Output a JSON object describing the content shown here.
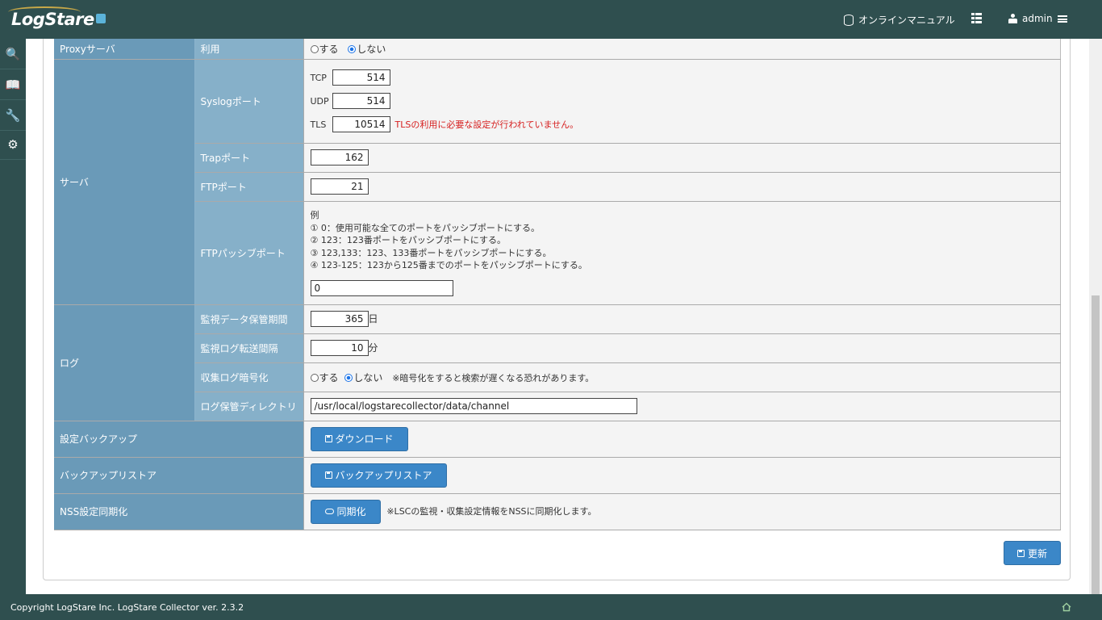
{
  "app": {
    "logo_text": "LogStare"
  },
  "topnav": {
    "manual_label": "オンラインマニュアル",
    "user_label": "admin"
  },
  "sidebar": {
    "items": [
      {
        "icon": "search-icon",
        "glyph": "🔍"
      },
      {
        "icon": "book-icon",
        "glyph": "📖"
      },
      {
        "icon": "wrench-icon",
        "glyph": "🔧"
      },
      {
        "icon": "gears-icon",
        "glyph": "⚙"
      }
    ]
  },
  "form": {
    "proxy": {
      "section": "Proxyサーバ",
      "label": "利用",
      "opt_yes": "する",
      "opt_no": "しない",
      "selected": "しない"
    },
    "server": {
      "section": "サーバ",
      "syslog_label": "Syslogポート",
      "tcp_label": "TCP",
      "tcp_value": "514",
      "udp_label": "UDP",
      "udp_value": "514",
      "tls_label": "TLS",
      "tls_value": "10514",
      "tls_warning": "TLSの利用に必要な設定が行われていません。",
      "trap_label": "Trapポート",
      "trap_value": "162",
      "ftp_label": "FTPポート",
      "ftp_value": "21",
      "passive_label": "FTPパッシブポート",
      "passive_help": [
        "例",
        "① 0：使用可能な全てのポートをパッシブポートにする。",
        "② 123：123番ポートをパッシブポートにする。",
        "③ 123,133：123、133番ポートをパッシブポートにする。",
        "④ 123-125：123から125番までのポートをパッシブポートにする。"
      ],
      "passive_value": "0"
    },
    "log": {
      "section": "ログ",
      "retention_label": "監視データ保管期間",
      "retention_value": "365",
      "retention_unit": "日",
      "interval_label": "監視ログ転送間隔",
      "interval_value": "10",
      "interval_unit": "分",
      "encrypt_label": "収集ログ暗号化",
      "encrypt_yes": "する",
      "encrypt_no": "しない",
      "encrypt_selected": "しない",
      "encrypt_note": "※暗号化をすると検索が遅くなる恐れがあります。",
      "dir_label": "ログ保管ディレクトリ",
      "dir_value": "/usr/local/logstarecollector/data/channel"
    },
    "backup": {
      "label": "設定バックアップ",
      "button": "ダウンロード"
    },
    "restore": {
      "label": "バックアップリストア",
      "button": "バックアップリストア"
    },
    "nss": {
      "label": "NSS設定同期化",
      "button": "同期化",
      "note": "※LSCの監視・収集設定情報をNSSに同期化します。"
    },
    "update_button": "更新"
  },
  "footer": {
    "copyright": "Copyright LogStare Inc. LogStare Collector ver. 2.3.2"
  },
  "colors": {
    "header": "#2f4f4f",
    "label_dark": "#6a9ab8",
    "label_light": "#86b0c9",
    "button": "#3b87c8",
    "warning": "#d62020"
  }
}
